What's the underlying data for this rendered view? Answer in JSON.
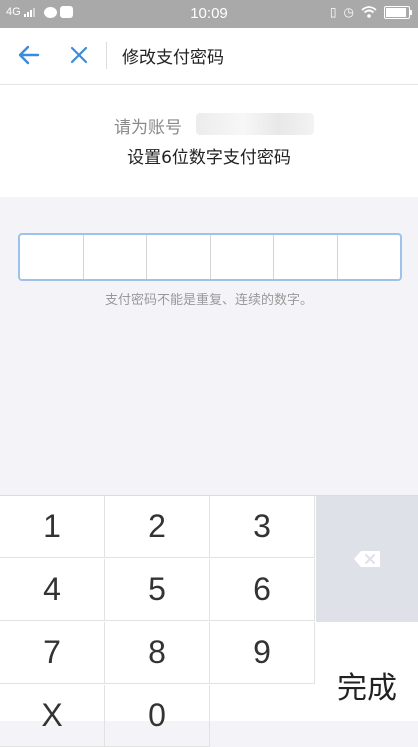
{
  "status_bar": {
    "network": "4G",
    "time": "10:09"
  },
  "nav": {
    "title": "修改支付密码"
  },
  "header": {
    "account_prefix": "请为账号",
    "instruction": "设置6位数字支付密码"
  },
  "pin": {
    "digits": [
      "",
      "",
      "",
      "",
      "",
      ""
    ],
    "hint": "支付密码不能是重复、连续的数字。"
  },
  "keypad": {
    "keys": [
      "1",
      "2",
      "3",
      "4",
      "5",
      "6",
      "7",
      "8",
      "9",
      "X",
      "0"
    ],
    "done_label": "完成"
  }
}
